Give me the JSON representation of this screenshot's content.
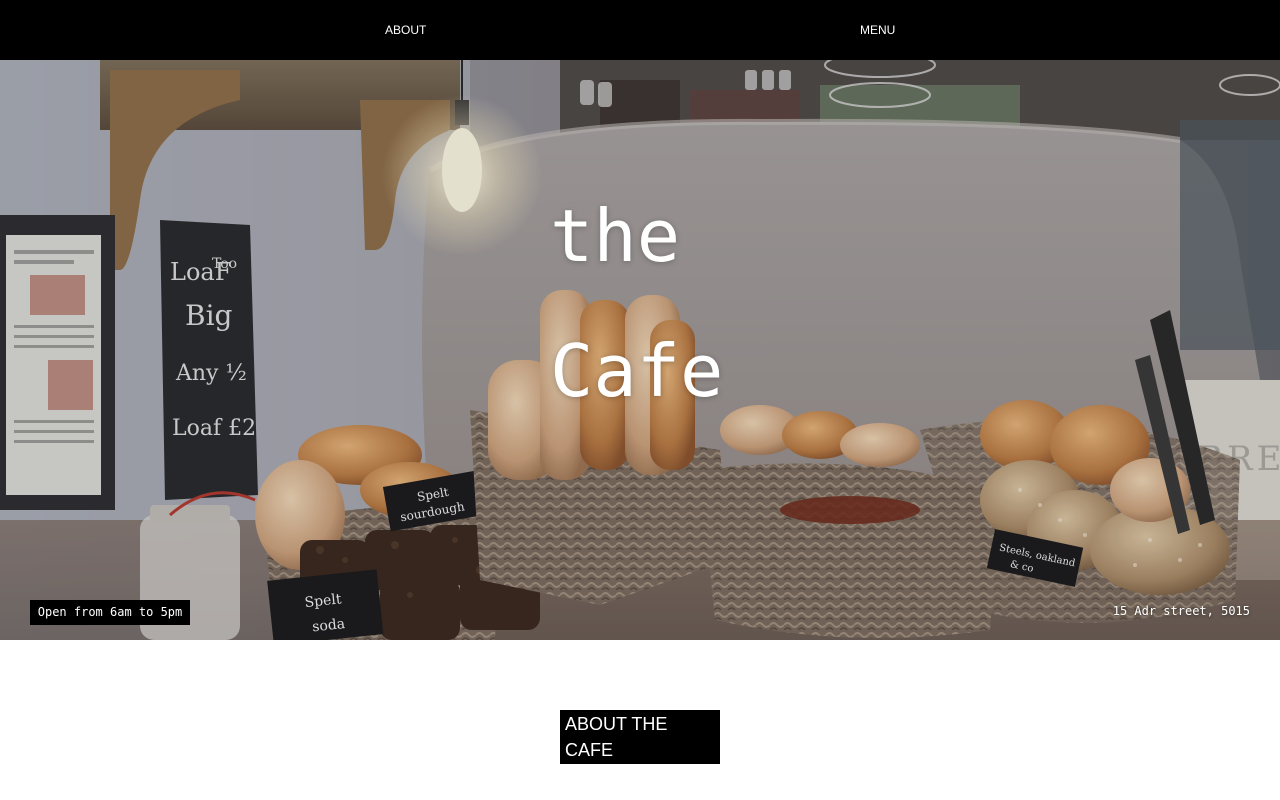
{
  "nav": {
    "about_label": "ABOUT",
    "menu_label": "MENU"
  },
  "hero": {
    "title_line1": "the",
    "title_line2": "Cafe",
    "hours": "Open from 6am to 5pm",
    "address": "15 Adr street, 5015",
    "chalkboard": [
      "LoaF Too",
      "Big",
      "Any ½",
      "Loaf £2"
    ],
    "signs": [
      "Spelt sourdough",
      "Spelt soda",
      "Steels, oakland & co"
    ],
    "wall_letters": "BRE"
  },
  "about": {
    "heading": "ABOUT THE CAFE"
  },
  "colors": {
    "nav_bg": "#000000",
    "text_light": "#ffffff",
    "badge_bg": "#000000",
    "page_bg": "#ffffff"
  }
}
